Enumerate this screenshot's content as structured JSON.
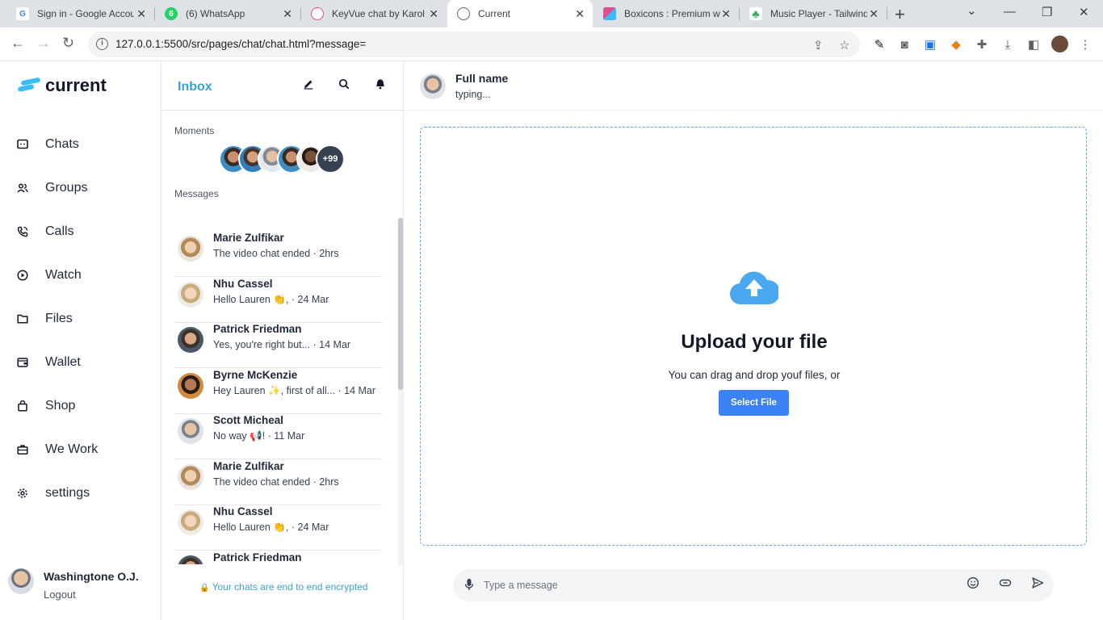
{
  "browser": {
    "tabs": [
      {
        "title": "Sign in - Google Accounts",
        "favicon_color": "#ffffff",
        "favicon_text": "G"
      },
      {
        "title": "(6) WhatsApp",
        "favicon_color": "#25d366",
        "favicon_text": "6"
      },
      {
        "title": "KeyVue chat by Karol",
        "favicon_color": "#ea4c89",
        "favicon_text": "◎"
      },
      {
        "title": "Current",
        "favicon_color": "#5f6368",
        "favicon_text": "◍"
      },
      {
        "title": "Boxicons : Premium w",
        "favicon_color": "#e44c8c",
        "favicon_text": "◆"
      },
      {
        "title": "Music Player - Tailwind",
        "favicon_color": "#3ba95c",
        "favicon_text": "♣"
      }
    ],
    "url": "127.0.0.1:5500/src/pages/chat/chat.html?message="
  },
  "brand": {
    "name": "current",
    "color": "#38bdf8"
  },
  "nav": [
    {
      "label": "Chats",
      "icon": "chat-icon",
      "glyph": "▫"
    },
    {
      "label": "Groups",
      "icon": "group-icon",
      "glyph": "⚇"
    },
    {
      "label": "Calls",
      "icon": "phone-icon",
      "glyph": "✆"
    },
    {
      "label": "Watch",
      "icon": "play-icon",
      "glyph": "⏵"
    },
    {
      "label": "Files",
      "icon": "folder-icon",
      "glyph": "▭"
    },
    {
      "label": "Wallet",
      "icon": "wallet-icon",
      "glyph": "▣"
    },
    {
      "label": "Shop",
      "icon": "shopping-bag-icon",
      "glyph": "⊓"
    },
    {
      "label": "We Work",
      "icon": "briefcase-icon",
      "glyph": "⊟"
    },
    {
      "label": "settings",
      "icon": "gear-icon",
      "glyph": "⚙"
    }
  ],
  "user": {
    "name": "Washingtone O.J.",
    "logout": "Logout"
  },
  "inbox": {
    "title": "Inbox",
    "moments_label": "Moments",
    "moments_more": "+99",
    "messages_label": "Messages",
    "encrypted_note": "Your chats are end to end encrypted",
    "messages": [
      {
        "name": "Marie Zulfikar",
        "text": "The video chat ended · 2hrs"
      },
      {
        "name": "Nhu Cassel",
        "text": "Hello Lauren 👏, · 24 Mar"
      },
      {
        "name": "Patrick Friedman",
        "text": "Yes, you're right but... · 14 Mar"
      },
      {
        "name": "Byrne McKenzie",
        "text": "Hey Lauren ✨, first of all... · 14 Mar"
      },
      {
        "name": "Scott Micheal",
        "text": "No way 📢! · 11 Mar"
      },
      {
        "name": "Marie Zulfikar",
        "text": "The video chat ended · 2hrs"
      },
      {
        "name": "Nhu Cassel",
        "text": "Hello Lauren 👏, · 24 Mar"
      },
      {
        "name": "Patrick Friedman",
        "text": ""
      }
    ]
  },
  "chat": {
    "contact_name": "Full name",
    "contact_status": "typing...",
    "upload_title": "Upload your file",
    "upload_subtitle": "You can drag and drop youf files, or",
    "select_button": "Select File",
    "composer_placeholder": "Type a message",
    "accent_color": "#3b82f6"
  }
}
